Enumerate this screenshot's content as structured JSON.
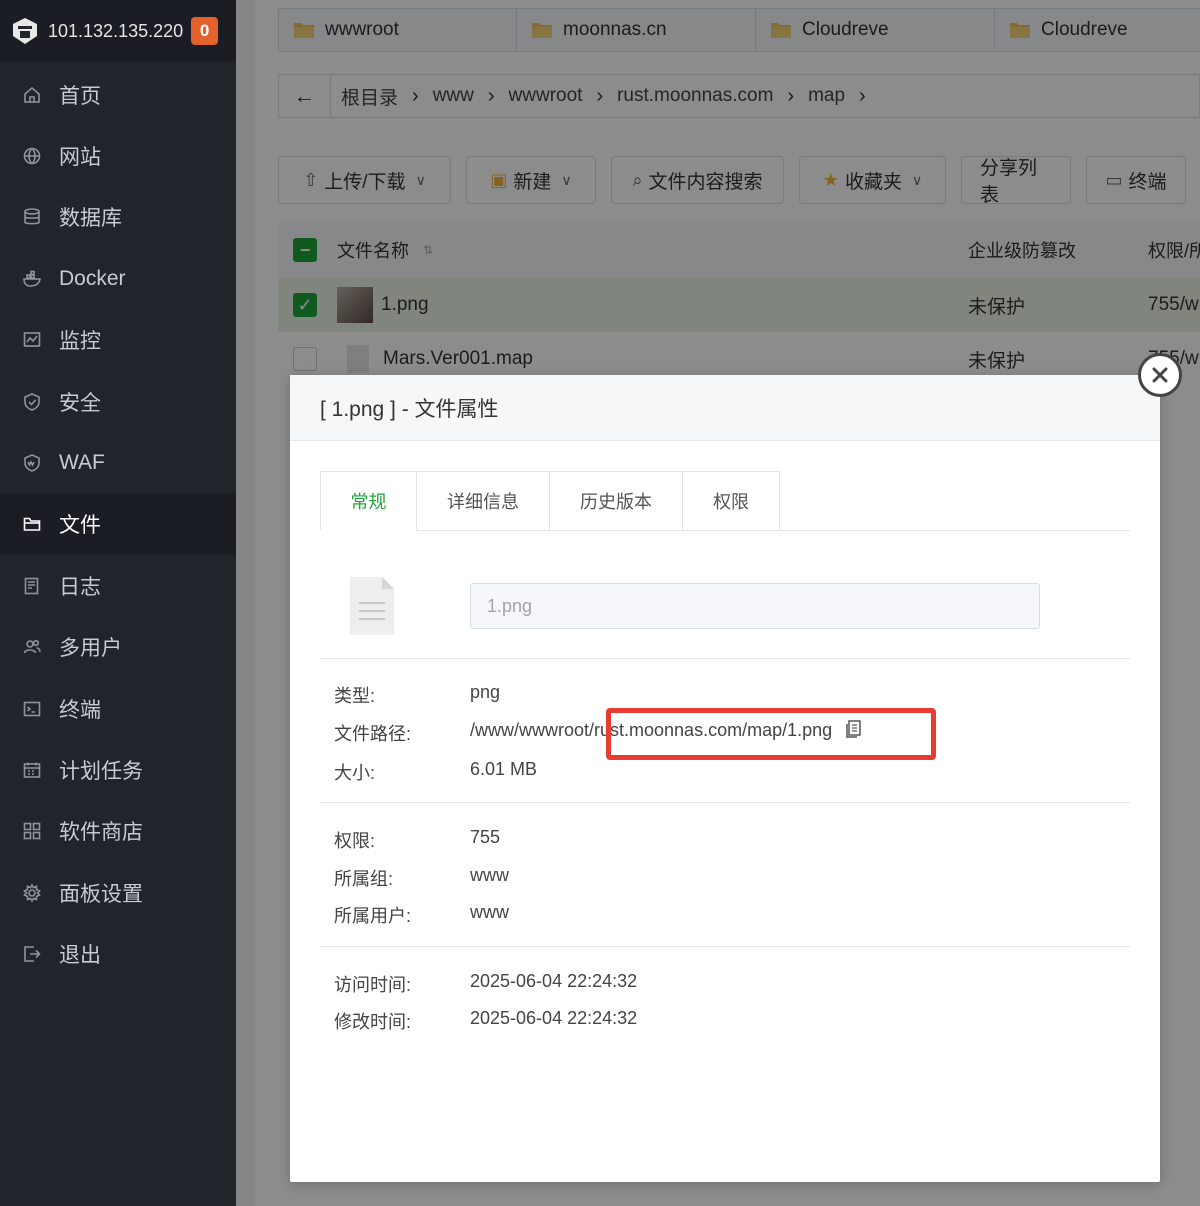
{
  "sidebar": {
    "ip": "101.132.135.220",
    "badge": "0",
    "items": [
      {
        "label": "首页",
        "icon": "home-icon"
      },
      {
        "label": "网站",
        "icon": "globe-icon"
      },
      {
        "label": "数据库",
        "icon": "database-icon"
      },
      {
        "label": "Docker",
        "icon": "docker-icon"
      },
      {
        "label": "监控",
        "icon": "monitor-icon"
      },
      {
        "label": "安全",
        "icon": "shield-icon"
      },
      {
        "label": "WAF",
        "icon": "waf-icon"
      },
      {
        "label": "文件",
        "icon": "folder-icon",
        "active": true
      },
      {
        "label": "日志",
        "icon": "log-icon"
      },
      {
        "label": "多用户",
        "icon": "users-icon"
      },
      {
        "label": "终端",
        "icon": "terminal-icon"
      },
      {
        "label": "计划任务",
        "icon": "calendar-icon"
      },
      {
        "label": "软件商店",
        "icon": "apps-icon"
      },
      {
        "label": "面板设置",
        "icon": "gear-icon"
      },
      {
        "label": "退出",
        "icon": "logout-icon"
      }
    ]
  },
  "folder_tabs": [
    "wwwroot",
    "moonnas.cn",
    "Cloudreve",
    "Cloudreve"
  ],
  "breadcrumb": [
    "根目录",
    "www",
    "wwwroot",
    "rust.moonnas.com",
    "map"
  ],
  "toolbar": {
    "upload": "上传/下载",
    "new": "新建",
    "search": "文件内容搜索",
    "favorites": "收藏夹",
    "share_list": "分享列表",
    "terminal": "终端"
  },
  "table": {
    "headers": {
      "name": "文件名称",
      "protect": "企业级防篡改",
      "perm": "权限/所"
    },
    "rows": [
      {
        "name": "1.png",
        "protect": "未保护",
        "perm": "755/w",
        "selected": true
      },
      {
        "name": "Mars.Ver001.map",
        "protect": "未保护",
        "perm": "755/w",
        "selected": false
      }
    ]
  },
  "dialog": {
    "title": "[ 1.png ] - 文件属性",
    "tabs": [
      "常规",
      "详细信息",
      "历史版本",
      "权限"
    ],
    "file_name": "1.png",
    "type_label": "类型:",
    "type_value": "png",
    "path_label": "文件路径:",
    "path_prefix": "/www/wwwroot/",
    "path_highlight": "rust.moonnas.com/map/1.png",
    "size_label": "大小:",
    "size_value": "6.01 MB",
    "perm_label": "权限:",
    "perm_value": "755",
    "group_label": "所属组:",
    "group_value": "www",
    "owner_label": "所属用户:",
    "owner_value": "www",
    "atime_label": "访问时间:",
    "atime_value": "2025-06-04 22:24:32",
    "mtime_label": "修改时间:",
    "mtime_value": "2025-06-04 22:24:32"
  },
  "colors": {
    "accent": "#20a53a",
    "highlight": "#e83b32",
    "sidebar": "#20242b"
  }
}
